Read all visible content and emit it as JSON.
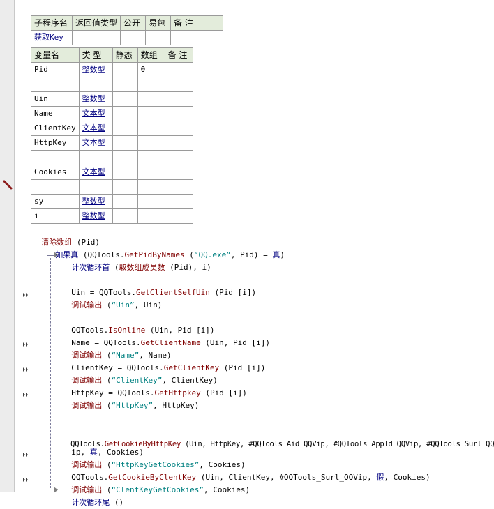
{
  "sub_table": {
    "headers": [
      "子程序名",
      "返回值类型",
      "公开",
      "易包",
      "备 注"
    ],
    "row": [
      "获取Key",
      "",
      "",
      "",
      ""
    ]
  },
  "var_table": {
    "headers": [
      "变量名",
      "类 型",
      "静态",
      "数组",
      "备 注"
    ],
    "rows": [
      [
        "Pid",
        "整数型",
        "",
        "0",
        ""
      ],
      [
        "",
        "",
        "",
        "",
        ""
      ],
      [
        "Uin",
        "整数型",
        "",
        "",
        ""
      ],
      [
        "Name",
        "文本型",
        "",
        "",
        ""
      ],
      [
        "ClientKey",
        "文本型",
        "",
        "",
        ""
      ],
      [
        "HttpKey",
        "文本型",
        "",
        "",
        ""
      ],
      [
        "",
        "",
        "",
        "",
        ""
      ],
      [
        "Cookies",
        "文本型",
        "",
        "",
        ""
      ],
      [
        "",
        "",
        "",
        "",
        ""
      ],
      [
        "sy",
        "整数型",
        "",
        "",
        ""
      ],
      [
        "i",
        "整数型",
        "",
        "",
        ""
      ]
    ]
  },
  "code": {
    "l1": {
      "a": "清除数组",
      "b": " (Pid)"
    },
    "l2": {
      "a": "如果真",
      "b": " (QQTools.",
      "c": "GetPidByNames",
      "d": " (",
      "e": "“QQ.exe”",
      "f": ", Pid) = ",
      "g": "真",
      "h": ")"
    },
    "l3": {
      "a": "计次循环首",
      "b": " (",
      "c": "取数组成员数",
      "d": " (Pid), i)"
    },
    "l4": {
      "a": "Uin = QQTools.",
      "b": "GetClientSelfUin",
      "c": " (Pid [i])"
    },
    "l5": {
      "a": "调试输出",
      "b": " (",
      "c": "“Uin”",
      "d": ", Uin)"
    },
    "l6": {
      "a": "QQTools.",
      "b": "IsOnline",
      "c": " (Uin, Pid [i])"
    },
    "l7": {
      "a": "Name = QQTools.",
      "b": "GetClientName",
      "c": " (Uin, Pid [i])"
    },
    "l8": {
      "a": "调试输出",
      "b": " (",
      "c": "“Name”",
      "d": ", Name)"
    },
    "l9": {
      "a": "ClientKey = QQTools.",
      "b": "GetClientKey",
      "c": " (Pid [i])"
    },
    "l10": {
      "a": "调试输出",
      "b": " (",
      "c": "“ClientKey”",
      "d": ", ClientKey)"
    },
    "l11": {
      "a": "HttpKey = QQTools.",
      "b": "GetHttpkey",
      "c": " (Pid [i])"
    },
    "l12": {
      "a": "调试输出",
      "b": " (",
      "c": "“HttpKey”",
      "d": ", HttpKey)"
    },
    "l13": {
      "a": "QQTools.",
      "b": "GetCookieByHttpKey",
      "c": " (Uin, HttpKey, #QQTools_Aid_QQVip, #QQTools_AppId_QQVip, #QQTools_Surl_QQV"
    },
    "l13b": {
      "a": "ip, ",
      "b": "真",
      "c": ", Cookies)"
    },
    "l14": {
      "a": "调试输出",
      "b": " (",
      "c": "“HttpKeyGetCookies”",
      "d": ", Cookies)"
    },
    "l15": {
      "a": "QQTools.",
      "b": "GetCookieByClentKey",
      "c": " (Uin, ClientKey, #QQTools_Surl_QQVip, ",
      "d": "假",
      "e": ", Cookies)"
    },
    "l16": {
      "a": "调试输出",
      "b": " (",
      "c": "“ClentKeyGetCookies”",
      "d": ", Cookies)"
    },
    "l17": {
      "a": "计次循环尾",
      "b": " ()"
    }
  },
  "colors": {
    "header_bg": "#e3ecdb",
    "keyword": "#000080",
    "function": "#800000",
    "string": "#008080"
  }
}
